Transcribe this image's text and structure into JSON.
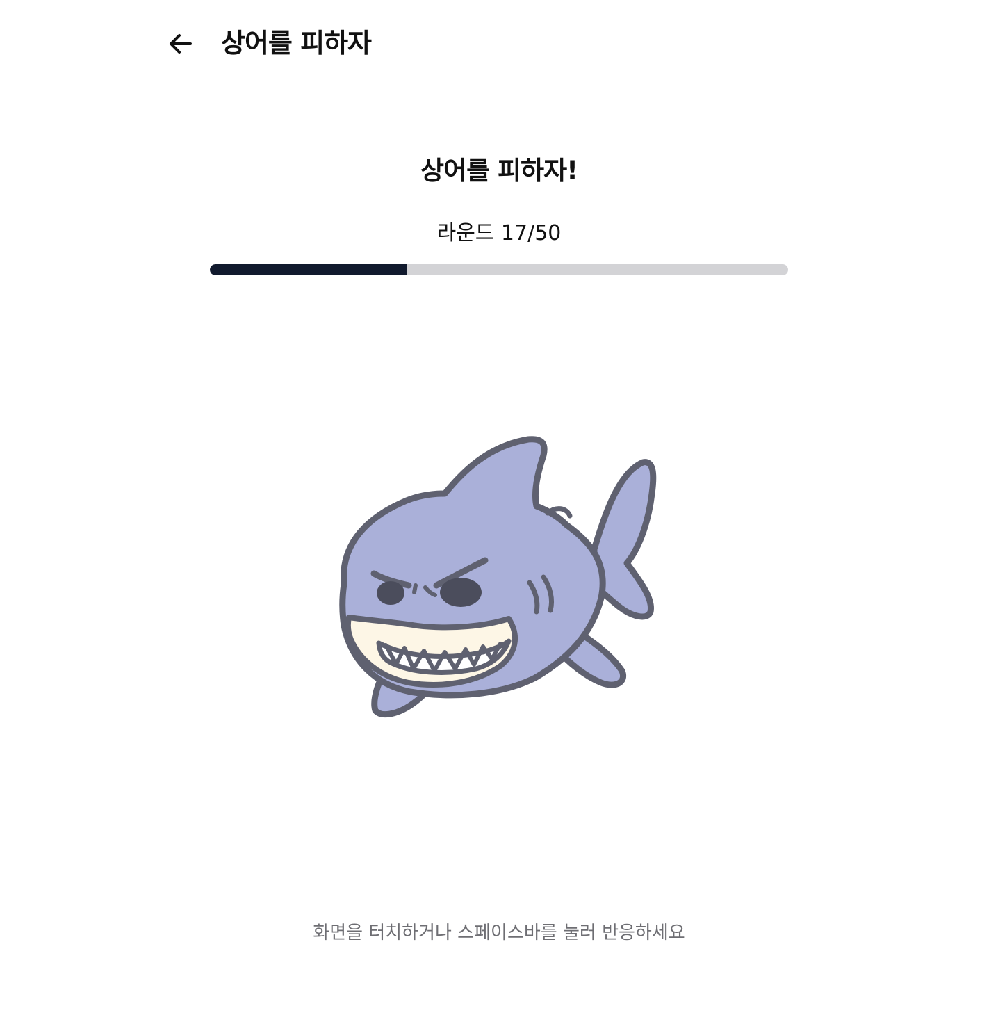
{
  "header": {
    "back_icon": "arrow-left-icon",
    "title": "상어를 피하자"
  },
  "game": {
    "title": "상어를 피하자!",
    "round_label": "라운드 17/50",
    "round_current": 17,
    "round_total": 50,
    "progress_fraction": 0.34,
    "character_icon": "angry-shark-icon",
    "hint": "화면을 터치하거나 스페이스바를 눌러 반응하세요"
  },
  "colors": {
    "progress_fill": "#111a2e",
    "progress_track": "#d3d3d6",
    "shark_body": "#aab0d9",
    "shark_outline": "#5f6170",
    "shark_belly": "#fdf6e6",
    "hint_text": "#6e6e73"
  }
}
